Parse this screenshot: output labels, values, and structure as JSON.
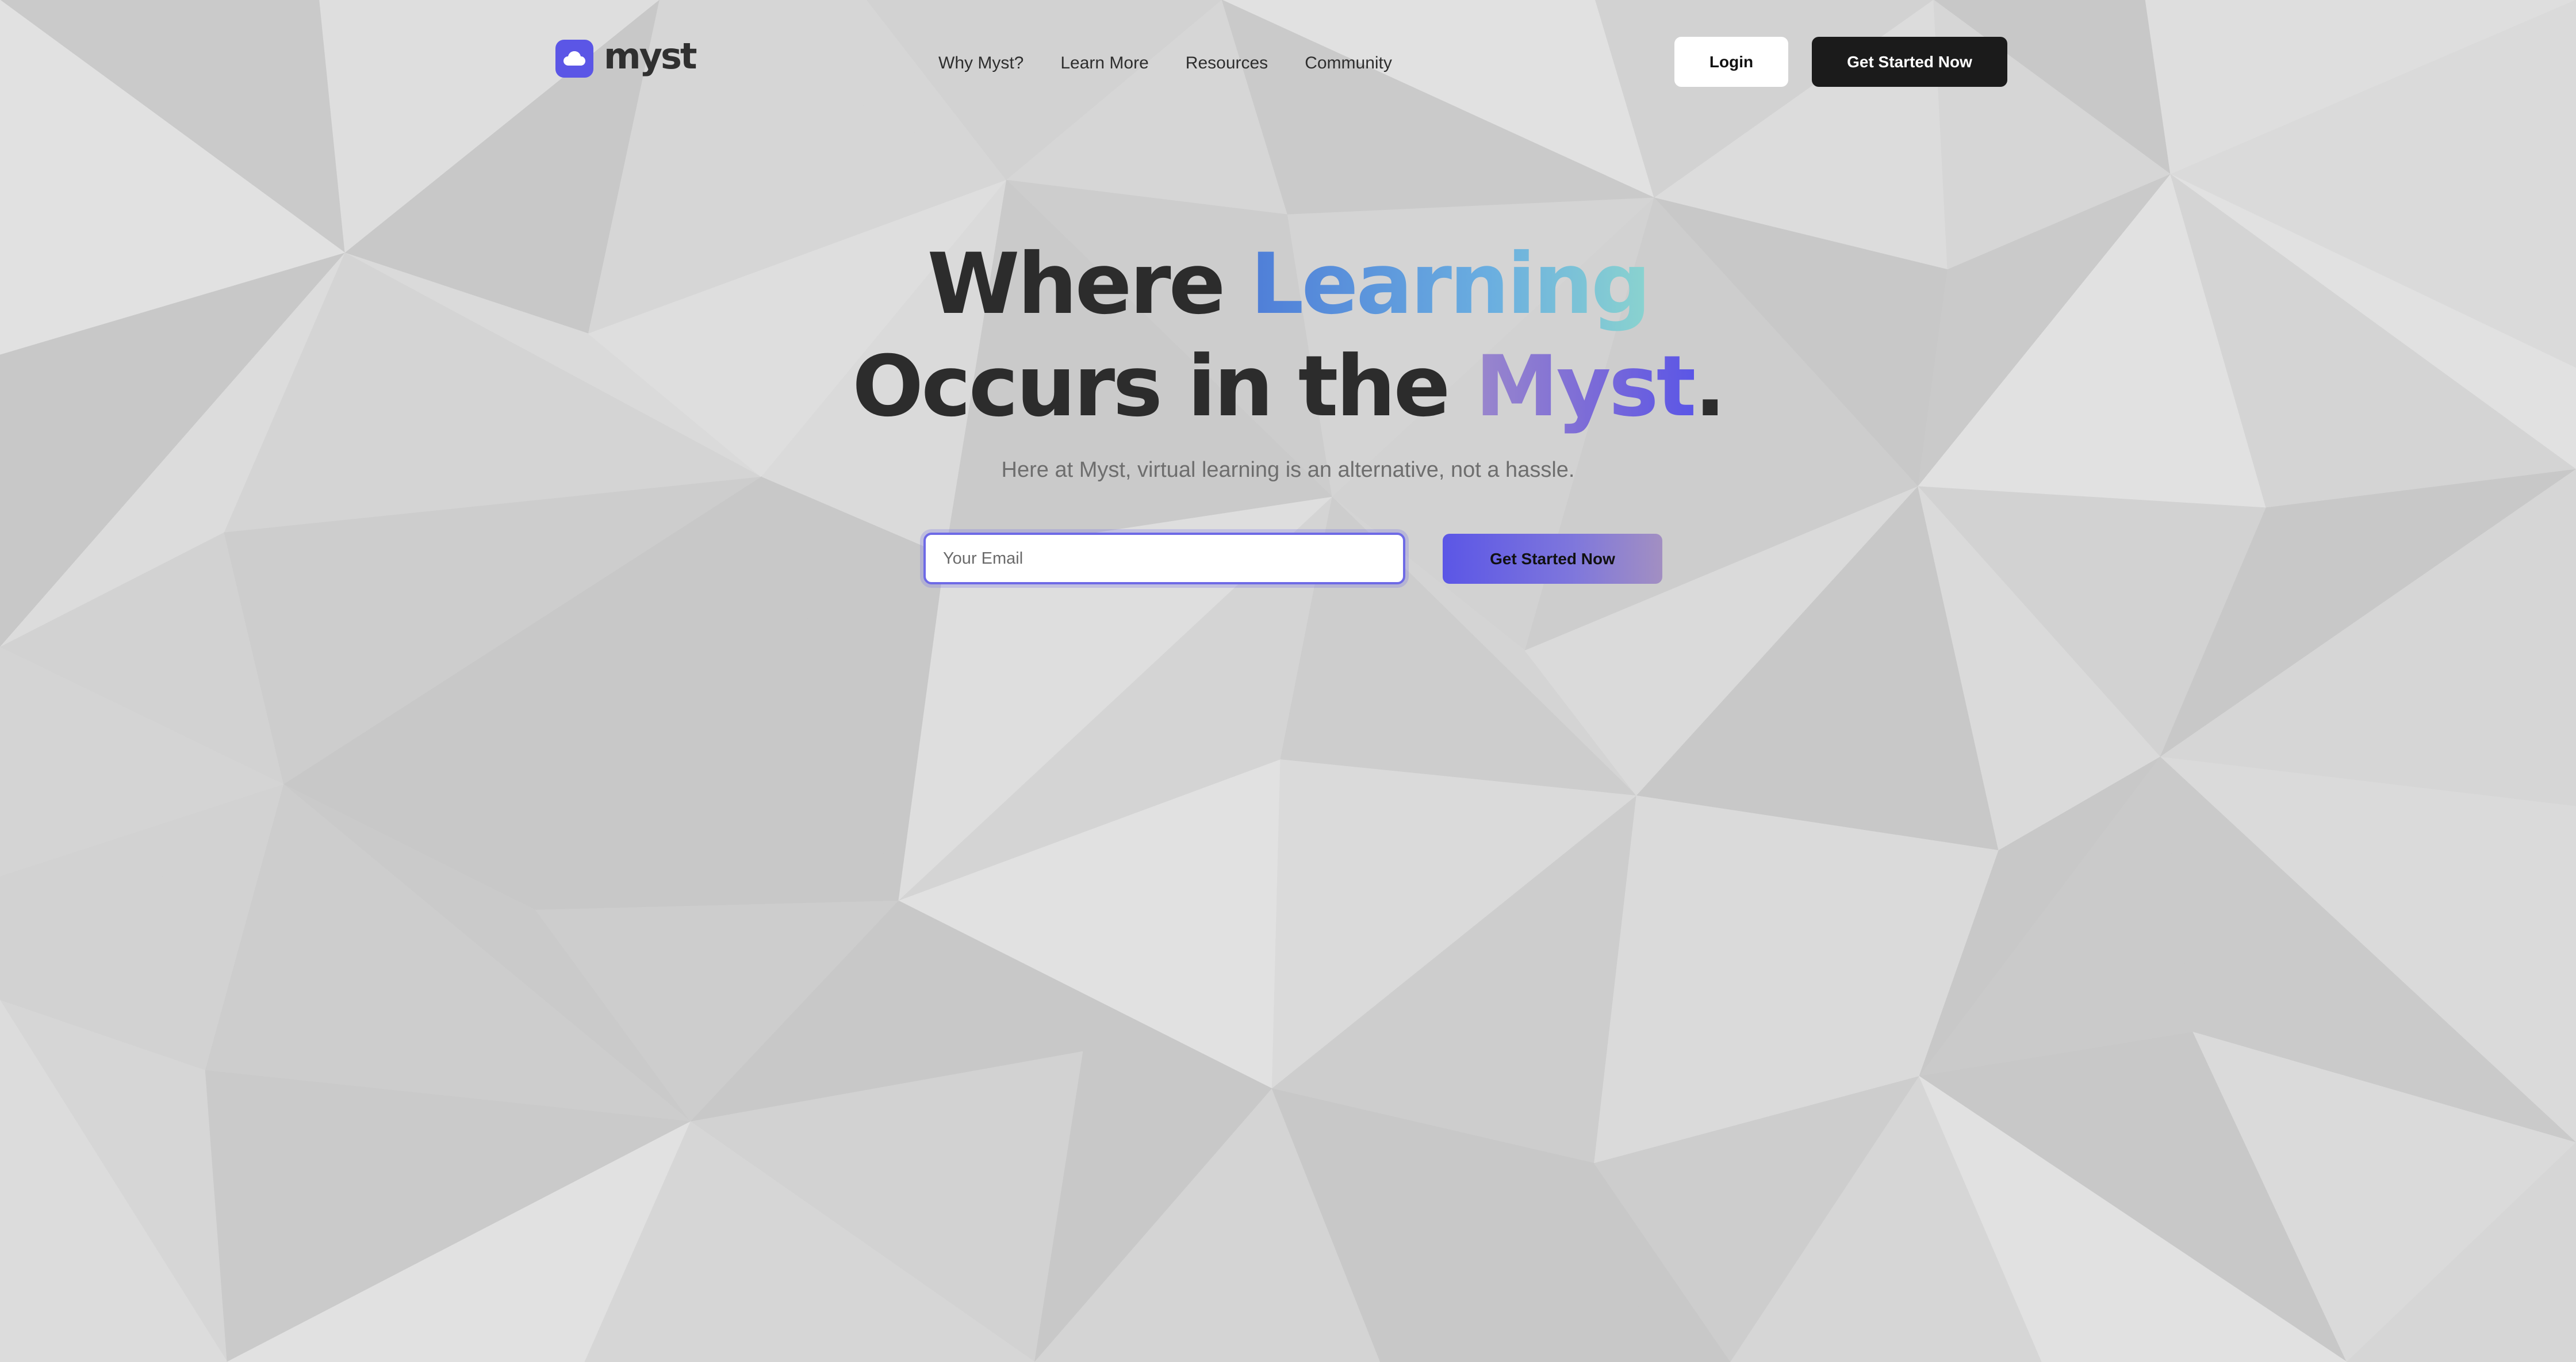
{
  "brand": {
    "name": "myst",
    "logo_icon": "cloud-icon",
    "accent_color": "#5b56e6"
  },
  "nav": {
    "links": [
      "Why Myst?",
      "Learn More",
      "Resources",
      "Community"
    ],
    "login_label": "Login",
    "cta_label": "Get Started Now"
  },
  "hero": {
    "title_line1_plain": "Where ",
    "title_line1_highlight": "Learning",
    "title_line2_plain": "Occurs in the ",
    "title_line2_highlight": "Myst",
    "title_line2_end": ".",
    "subtitle": "Here at Myst, virtual learning is an alternative, not a hassle.",
    "email_placeholder": "Your Email",
    "cta_label": "Get Started Now"
  },
  "colors": {
    "background": "#d6d6d6",
    "dark_button": "#1b1b1b",
    "heading_text": "#2c2c2c"
  }
}
